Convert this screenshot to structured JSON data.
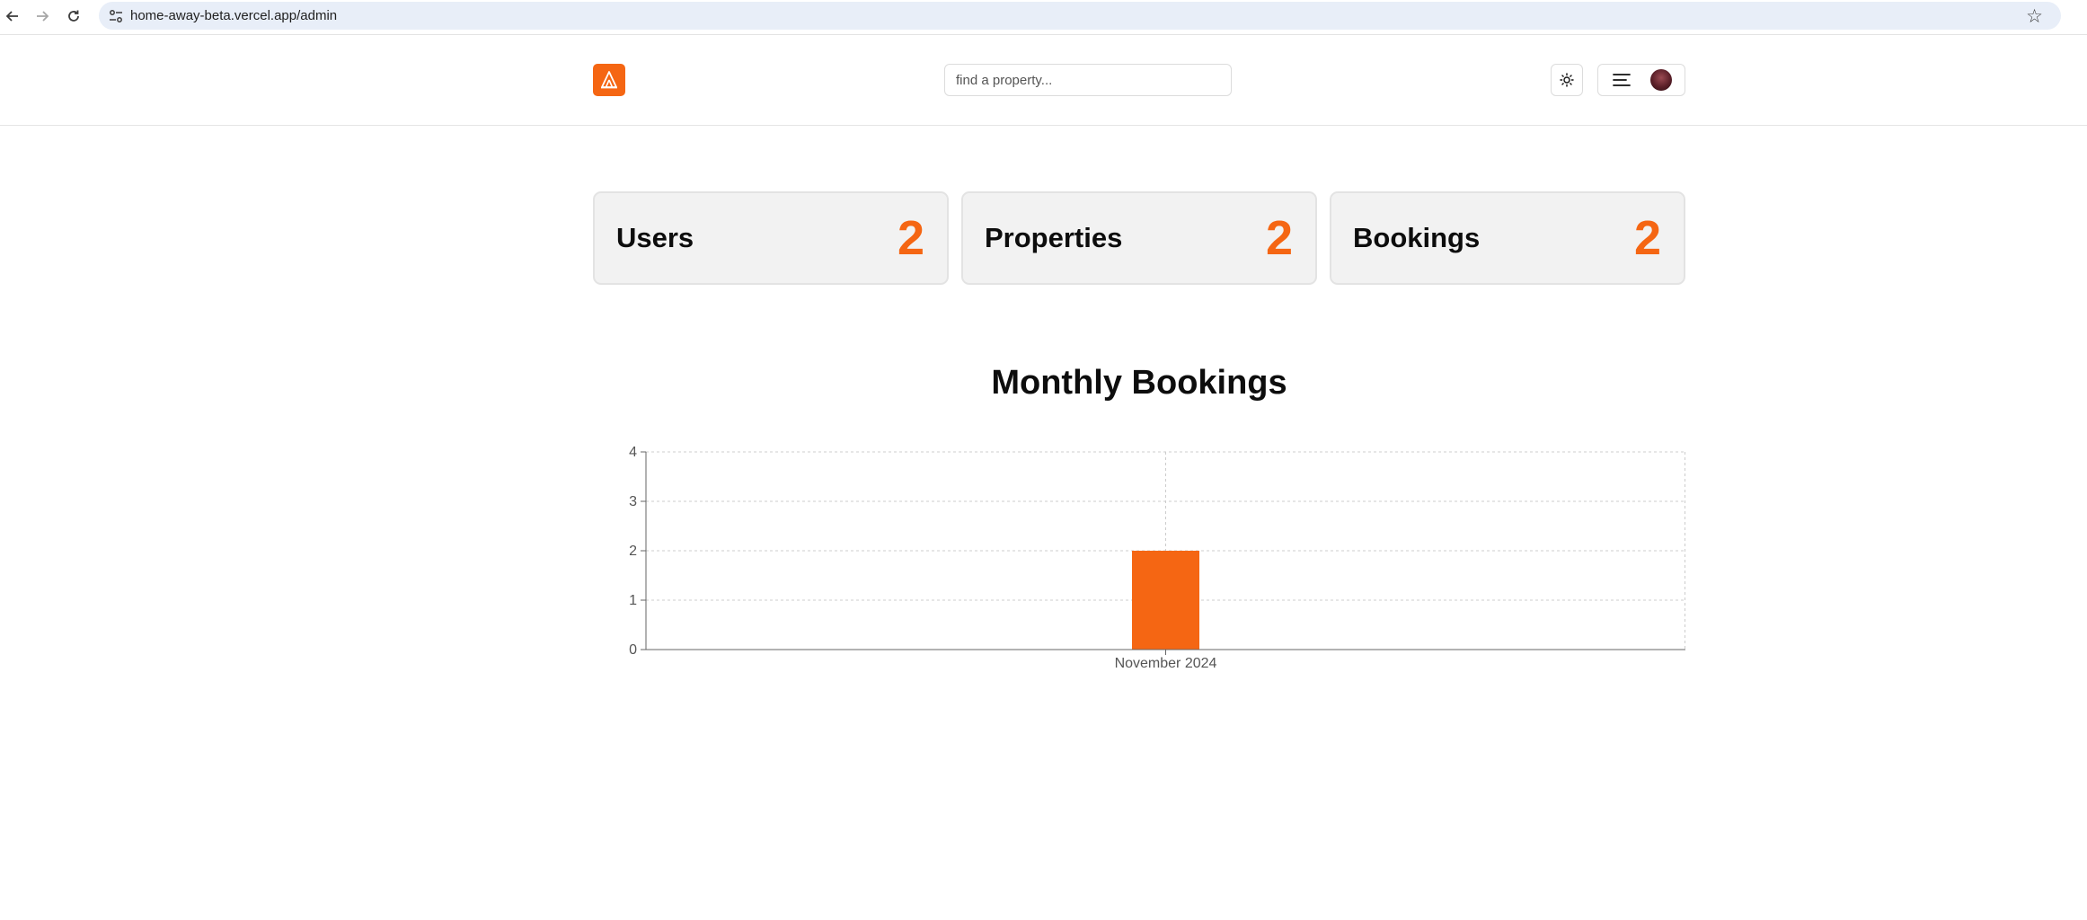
{
  "browser": {
    "url": "home-away-beta.vercel.app/admin",
    "back_icon": "arrow-left-icon",
    "forward_icon": "arrow-right-icon",
    "reload_icon": "reload-icon",
    "bookmark_icon": "star-icon"
  },
  "header": {
    "logo_icon": "tent-icon",
    "search": {
      "placeholder": "find a property...",
      "value": ""
    },
    "theme_icon": "sun-icon",
    "menu_icon": "hamburger-icon",
    "avatar": "user-avatar"
  },
  "stats": [
    {
      "label": "Users",
      "value": "2"
    },
    {
      "label": "Properties",
      "value": "2"
    },
    {
      "label": "Bookings",
      "value": "2"
    }
  ],
  "colors": {
    "accent": "#f56613",
    "card_bg": "#f2f2f2"
  },
  "chart": {
    "title": "Monthly Bookings"
  },
  "chart_data": {
    "type": "bar",
    "title": "Monthly Bookings",
    "categories": [
      "November 2024"
    ],
    "values": [
      2
    ],
    "xlabel": "",
    "ylabel": "",
    "ylim": [
      0,
      4
    ],
    "yticks": [
      0,
      1,
      2,
      3,
      4
    ],
    "grid": true,
    "bar_color": "#f56613"
  }
}
